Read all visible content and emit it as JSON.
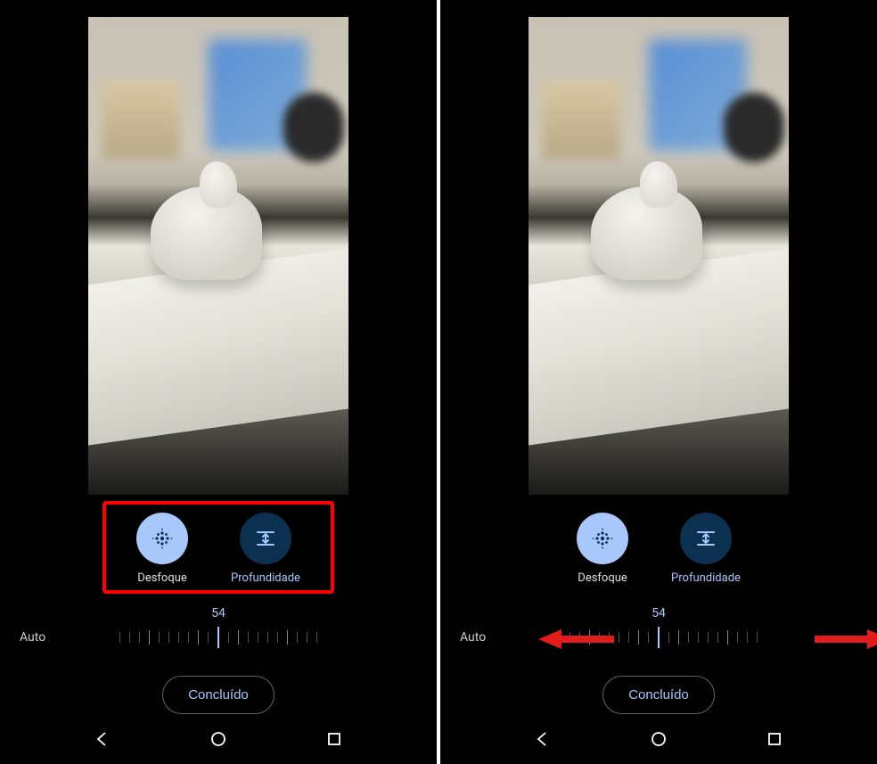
{
  "left": {
    "options": {
      "blur": {
        "label": "Desfoque",
        "selected": true
      },
      "depth": {
        "label": "Profundidade",
        "selected": false
      }
    },
    "slider": {
      "value": "54",
      "auto_label": "Auto"
    },
    "done_label": "Concluído",
    "highlight": true
  },
  "right": {
    "options": {
      "blur": {
        "label": "Desfoque",
        "selected": true
      },
      "depth": {
        "label": "Profundidade",
        "selected": false
      }
    },
    "slider": {
      "value": "54",
      "auto_label": "Auto"
    },
    "done_label": "Concluído",
    "arrows": true
  },
  "icons": {
    "blur": "dot-grid-icon",
    "depth": "depth-arrows-icon"
  },
  "colors": {
    "accent": "#a8c7fa",
    "highlight": "#ff0000",
    "arrow": "#e31b1b"
  }
}
